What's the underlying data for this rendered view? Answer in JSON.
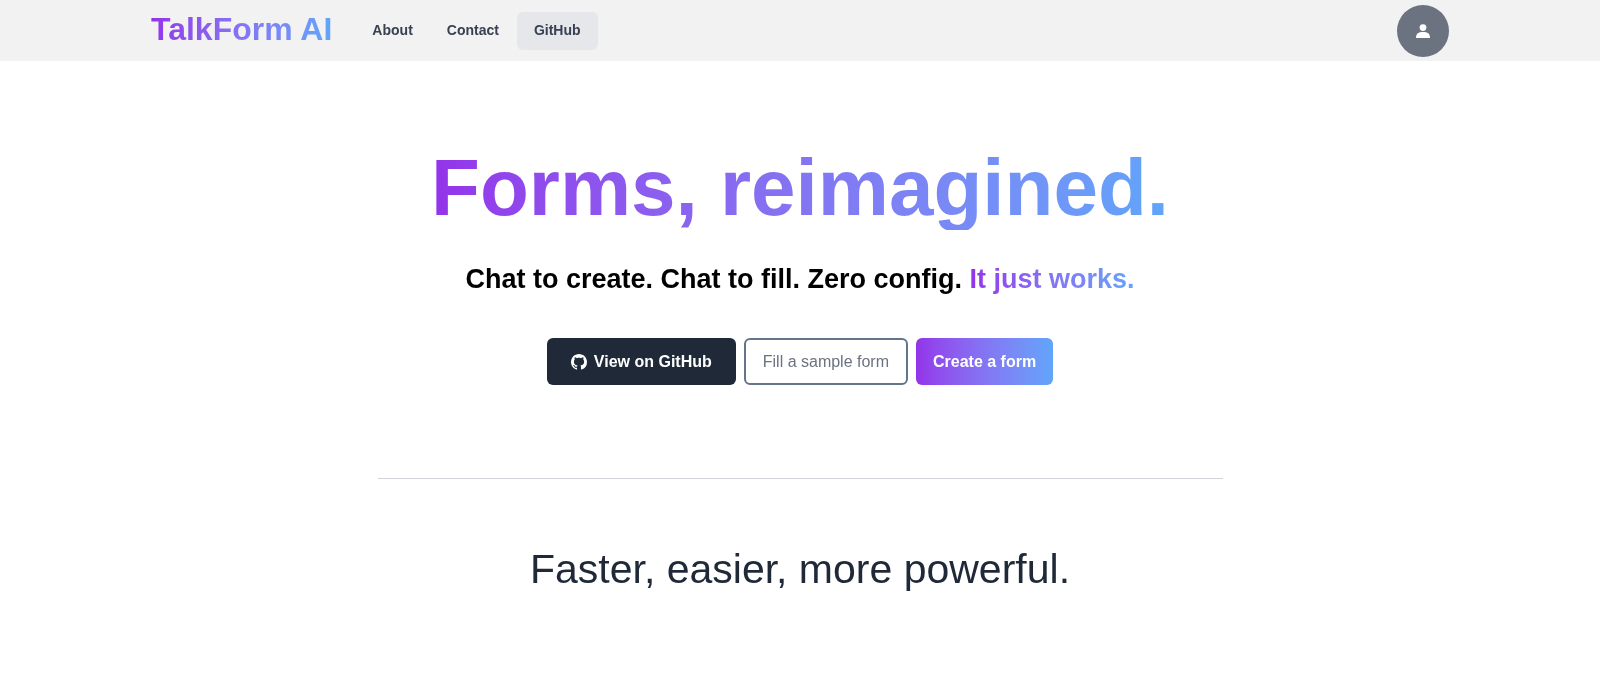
{
  "navbar": {
    "logo": "TalkForm AI",
    "links": [
      {
        "label": "About",
        "selected": false
      },
      {
        "label": "Contact",
        "selected": false
      },
      {
        "label": "GitHub",
        "selected": true
      }
    ]
  },
  "hero": {
    "title": "Forms, reimagined.",
    "subtitle": {
      "text": "Chat to create. Chat to fill. Zero config.",
      "highlight": "It just works."
    },
    "buttons": [
      {
        "label": "View on GitHub",
        "kind": "dark"
      },
      {
        "label": "Fill a sample form",
        "kind": "outline"
      },
      {
        "label": "Create a form",
        "kind": "gradient"
      }
    ]
  },
  "features": {
    "heading": "Faster, easier, more powerful."
  }
}
